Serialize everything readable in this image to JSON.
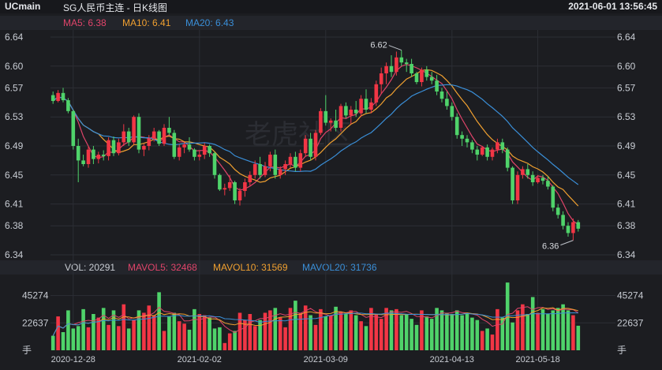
{
  "header": {
    "symbol": "UCmain",
    "title": "SG人民币主连 - 日K线图",
    "datetime": "2021-06-01 13:56:45"
  },
  "price_legend": {
    "ma5": "MA5: 6.38",
    "ma10": "MA10: 6.41",
    "ma20": "MA20: 6.43"
  },
  "volume_legend": {
    "vol": "VOL: 20291",
    "mavol5": "MAVOL5: 32468",
    "mavol10": "MAVOL10: 31569",
    "mavol20": "MAVOL20: 31736"
  },
  "watermark": "老虎社区",
  "colors": {
    "up": "#f23645",
    "down": "#4fd36a",
    "ma5": "#e0446a",
    "ma10": "#f0a030",
    "ma20": "#3a8fd8",
    "grid": "#2c2e35"
  },
  "chart_data": [
    {
      "type": "candlestick",
      "title": "SG人民币主连 - 日K线图",
      "ylim": [
        6.34,
        6.64
      ],
      "y_ticks": [
        "6.64",
        "6.60",
        "6.57",
        "6.53",
        "6.49",
        "6.45",
        "6.41",
        "6.38",
        "6.34"
      ],
      "x_ticks": [
        "2020-12-28",
        "2021-02-02",
        "2021-03-09",
        "2021-04-13",
        "2021-05-18"
      ],
      "annotations": [
        {
          "label": "6.62",
          "value": 6.62
        },
        {
          "label": "6.36",
          "value": 6.36
        }
      ],
      "ohlc": [
        [
          6.56,
          6.565,
          6.548,
          6.552
        ],
        [
          6.552,
          6.567,
          6.55,
          6.563
        ],
        [
          6.563,
          6.57,
          6.55,
          6.553
        ],
        [
          6.553,
          6.556,
          6.535,
          6.538
        ],
        [
          6.538,
          6.54,
          6.485,
          6.49
        ],
        [
          6.49,
          6.5,
          6.44,
          6.47
        ],
        [
          6.47,
          6.478,
          6.462,
          6.465
        ],
        [
          6.465,
          6.49,
          6.46,
          6.485
        ],
        [
          6.485,
          6.49,
          6.465,
          6.472
        ],
        [
          6.472,
          6.482,
          6.466,
          6.478
        ],
        [
          6.478,
          6.484,
          6.47,
          6.476
        ],
        [
          6.476,
          6.502,
          6.47,
          6.498
        ],
        [
          6.498,
          6.503,
          6.476,
          6.48
        ],
        [
          6.48,
          6.5,
          6.477,
          6.495
        ],
        [
          6.495,
          6.52,
          6.49,
          6.51
        ],
        [
          6.51,
          6.515,
          6.49,
          6.495
        ],
        [
          6.495,
          6.532,
          6.492,
          6.53
        ],
        [
          6.53,
          6.535,
          6.48,
          6.485
        ],
        [
          6.485,
          6.493,
          6.476,
          6.49
        ],
        [
          6.49,
          6.505,
          6.484,
          6.5
        ],
        [
          6.5,
          6.515,
          6.496,
          6.51
        ],
        [
          6.51,
          6.512,
          6.49,
          6.493
        ],
        [
          6.493,
          6.52,
          6.49,
          6.515
        ],
        [
          6.515,
          6.53,
          6.505,
          6.508
        ],
        [
          6.508,
          6.512,
          6.472,
          6.475
        ],
        [
          6.475,
          6.492,
          6.47,
          6.488
        ],
        [
          6.488,
          6.495,
          6.48,
          6.492
        ],
        [
          6.492,
          6.502,
          6.482,
          6.485
        ],
        [
          6.485,
          6.487,
          6.47,
          6.475
        ],
        [
          6.475,
          6.484,
          6.47,
          6.478
        ],
        [
          6.478,
          6.494,
          6.472,
          6.49
        ],
        [
          6.49,
          6.492,
          6.475,
          6.48
        ],
        [
          6.48,
          6.482,
          6.445,
          6.45
        ],
        [
          6.45,
          6.452,
          6.428,
          6.43
        ],
        [
          6.43,
          6.438,
          6.422,
          6.432
        ],
        [
          6.432,
          6.45,
          6.428,
          6.44
        ],
        [
          6.44,
          6.442,
          6.41,
          6.415
        ],
        [
          6.415,
          6.432,
          6.408,
          6.428
        ],
        [
          6.428,
          6.445,
          6.42,
          6.44
        ],
        [
          6.44,
          6.455,
          6.435,
          6.45
        ],
        [
          6.45,
          6.47,
          6.445,
          6.465
        ],
        [
          6.465,
          6.475,
          6.445,
          6.45
        ],
        [
          6.45,
          6.468,
          6.447,
          6.462
        ],
        [
          6.462,
          6.482,
          6.455,
          6.478
        ],
        [
          6.478,
          6.485,
          6.445,
          6.45
        ],
        [
          6.45,
          6.462,
          6.445,
          6.458
        ],
        [
          6.458,
          6.47,
          6.45,
          6.465
        ],
        [
          6.465,
          6.48,
          6.46,
          6.475
        ],
        [
          6.475,
          6.482,
          6.455,
          6.46
        ],
        [
          6.46,
          6.485,
          6.455,
          6.48
        ],
        [
          6.48,
          6.505,
          6.475,
          6.5
        ],
        [
          6.5,
          6.508,
          6.47,
          6.475
        ],
        [
          6.475,
          6.512,
          6.47,
          6.508
        ],
        [
          6.508,
          6.542,
          6.505,
          6.538
        ],
        [
          6.538,
          6.56,
          6.518,
          6.522
        ],
        [
          6.522,
          6.528,
          6.51,
          6.525
        ],
        [
          6.525,
          6.54,
          6.51,
          6.515
        ],
        [
          6.515,
          6.548,
          6.51,
          6.545
        ],
        [
          6.545,
          6.55,
          6.528,
          6.532
        ],
        [
          6.532,
          6.545,
          6.52,
          6.54
        ],
        [
          6.54,
          6.552,
          6.53,
          6.535
        ],
        [
          6.535,
          6.56,
          6.53,
          6.555
        ],
        [
          6.555,
          6.568,
          6.535,
          6.54
        ],
        [
          6.54,
          6.556,
          6.535,
          6.55
        ],
        [
          6.55,
          6.58,
          6.545,
          6.575
        ],
        [
          6.575,
          6.598,
          6.562,
          6.59
        ],
        [
          6.59,
          6.605,
          6.575,
          6.6
        ],
        [
          6.6,
          6.615,
          6.585,
          6.592
        ],
        [
          6.592,
          6.62,
          6.587,
          6.612
        ],
        [
          6.612,
          6.622,
          6.6,
          6.605
        ],
        [
          6.605,
          6.61,
          6.592,
          6.603
        ],
        [
          6.603,
          6.61,
          6.585,
          6.59
        ],
        [
          6.59,
          6.592,
          6.575,
          6.578
        ],
        [
          6.578,
          6.598,
          6.572,
          6.595
        ],
        [
          6.595,
          6.6,
          6.58,
          6.585
        ],
        [
          6.585,
          6.592,
          6.575,
          6.58
        ],
        [
          6.58,
          6.588,
          6.56,
          6.565
        ],
        [
          6.565,
          6.57,
          6.55,
          6.555
        ],
        [
          6.555,
          6.565,
          6.54,
          6.545
        ],
        [
          6.545,
          6.55,
          6.525,
          6.53
        ],
        [
          6.53,
          6.535,
          6.5,
          6.505
        ],
        [
          6.505,
          6.51,
          6.49,
          6.5
        ],
        [
          6.5,
          6.505,
          6.488,
          6.495
        ],
        [
          6.495,
          6.498,
          6.48,
          6.485
        ],
        [
          6.485,
          6.49,
          6.47,
          6.478
        ],
        [
          6.478,
          6.49,
          6.476,
          6.488
        ],
        [
          6.488,
          6.492,
          6.47,
          6.475
        ],
        [
          6.475,
          6.488,
          6.47,
          6.485
        ],
        [
          6.485,
          6.5,
          6.48,
          6.495
        ],
        [
          6.495,
          6.5,
          6.48,
          6.485
        ],
        [
          6.485,
          6.488,
          6.455,
          6.46
        ],
        [
          6.46,
          6.462,
          6.41,
          6.415
        ],
        [
          6.415,
          6.455,
          6.41,
          6.45
        ],
        [
          6.45,
          6.462,
          6.445,
          6.458
        ],
        [
          6.458,
          6.465,
          6.445,
          6.45
        ],
        [
          6.45,
          6.455,
          6.435,
          6.44
        ],
        [
          6.44,
          6.45,
          6.438,
          6.446
        ],
        [
          6.446,
          6.45,
          6.437,
          6.442
        ],
        [
          6.442,
          6.448,
          6.43,
          6.434
        ],
        [
          6.434,
          6.436,
          6.4,
          6.405
        ],
        [
          6.405,
          6.41,
          6.39,
          6.395
        ],
        [
          6.395,
          6.4,
          6.375,
          6.38
        ],
        [
          6.38,
          6.385,
          6.365,
          6.37
        ],
        [
          6.37,
          6.39,
          6.36,
          6.385
        ],
        [
          6.385,
          6.388,
          6.372,
          6.376
        ]
      ],
      "series": [
        {
          "name": "MA5",
          "value": 6.38
        },
        {
          "name": "MA10",
          "value": 6.41
        },
        {
          "name": "MA20",
          "value": 6.43
        }
      ]
    },
    {
      "type": "bar",
      "ylim": [
        0,
        60000
      ],
      "y_ticks": [
        "45274",
        "22637",
        "手"
      ],
      "volume": [
        12000,
        28000,
        15000,
        33000,
        18000,
        20000,
        34000,
        19000,
        30000,
        27000,
        35000,
        21000,
        33000,
        20000,
        38000,
        18000,
        25000,
        33000,
        31000,
        37000,
        29000,
        48000,
        16000,
        28000,
        31000,
        24000,
        22000,
        17000,
        34000,
        30000,
        29000,
        27000,
        18000,
        19000,
        6000,
        14000,
        16000,
        31000,
        25000,
        30000,
        20000,
        25000,
        31000,
        33000,
        35000,
        27000,
        19000,
        35000,
        41000,
        31000,
        37000,
        29000,
        21000,
        34000,
        28000,
        29000,
        36000,
        32000,
        30000,
        33000,
        29000,
        24000,
        20000,
        35000,
        30000,
        26000,
        35000,
        33000,
        34000,
        29000,
        30000,
        26000,
        21000,
        33000,
        28000,
        26000,
        35000,
        33000,
        31000,
        30000,
        33000,
        29000,
        31000,
        27000,
        25000,
        16000,
        18000,
        13000,
        34000,
        27000,
        56000,
        23000,
        33000,
        38000,
        30000,
        44000,
        31000,
        34000,
        30000,
        33000,
        35000,
        38000,
        33000,
        29000,
        20291
      ]
    }
  ]
}
